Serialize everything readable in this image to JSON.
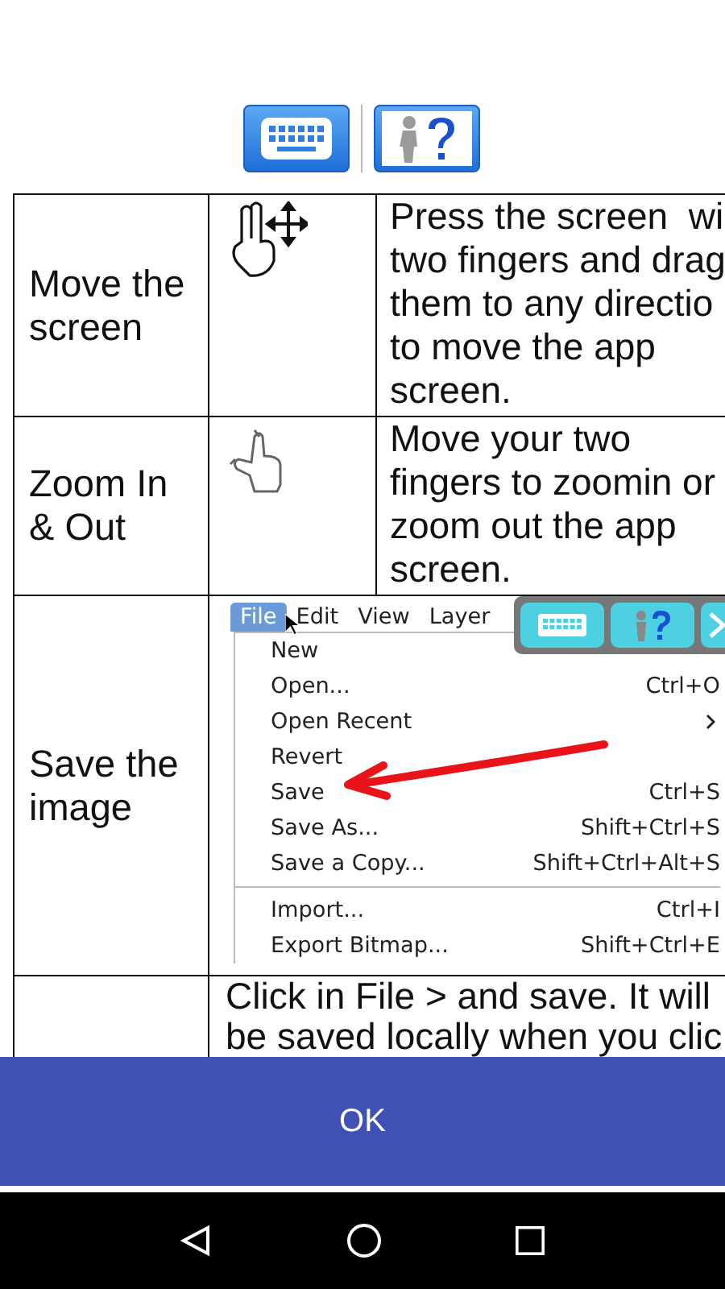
{
  "rows": [
    {
      "kind": "drag",
      "title": "Move the screen",
      "lines": [
        "Press the screen  wi",
        "two fingers and drag",
        "them to any directio",
        "to move the app",
        "screen."
      ]
    },
    {
      "kind": "pinch",
      "title": "Zoom In & Out",
      "lines": [
        "Move your two",
        "fingers to zoomin or",
        "zoom out the app",
        "screen."
      ]
    },
    {
      "kind": "screenshot",
      "title": "Save the image",
      "screenshot": {
        "menubar": [
          {
            "label": "File",
            "selected": true
          },
          {
            "label": "Edit",
            "selected": false
          },
          {
            "label": "View",
            "selected": false
          },
          {
            "label": "Layer",
            "selected": false
          }
        ],
        "items": [
          {
            "kind": "item",
            "label": "New"
          },
          {
            "kind": "item",
            "label": "Open...",
            "shortcut": "Ctrl+O"
          },
          {
            "kind": "submenu",
            "label": "Open Recent"
          },
          {
            "kind": "item",
            "label": "Revert"
          },
          {
            "kind": "item",
            "label": "Save",
            "shortcut": "Ctrl+S"
          },
          {
            "kind": "item",
            "label": "Save As...",
            "shortcut": "Shift+Ctrl+S"
          },
          {
            "kind": "item",
            "label": "Save a Copy...",
            "shortcut": "Shift+Ctrl+Alt+S"
          },
          {
            "kind": "separator"
          },
          {
            "kind": "item",
            "label": "Import...",
            "shortcut": "Ctrl+I"
          },
          {
            "kind": "item",
            "label": "Export Bitmap...",
            "shortcut": "Shift+Ctrl+E"
          }
        ]
      }
    },
    {
      "kind": "wide",
      "lines": [
        "Click in File > and save. It will",
        "be saved locally when you clic"
      ]
    }
  ],
  "ok_button": "OK"
}
